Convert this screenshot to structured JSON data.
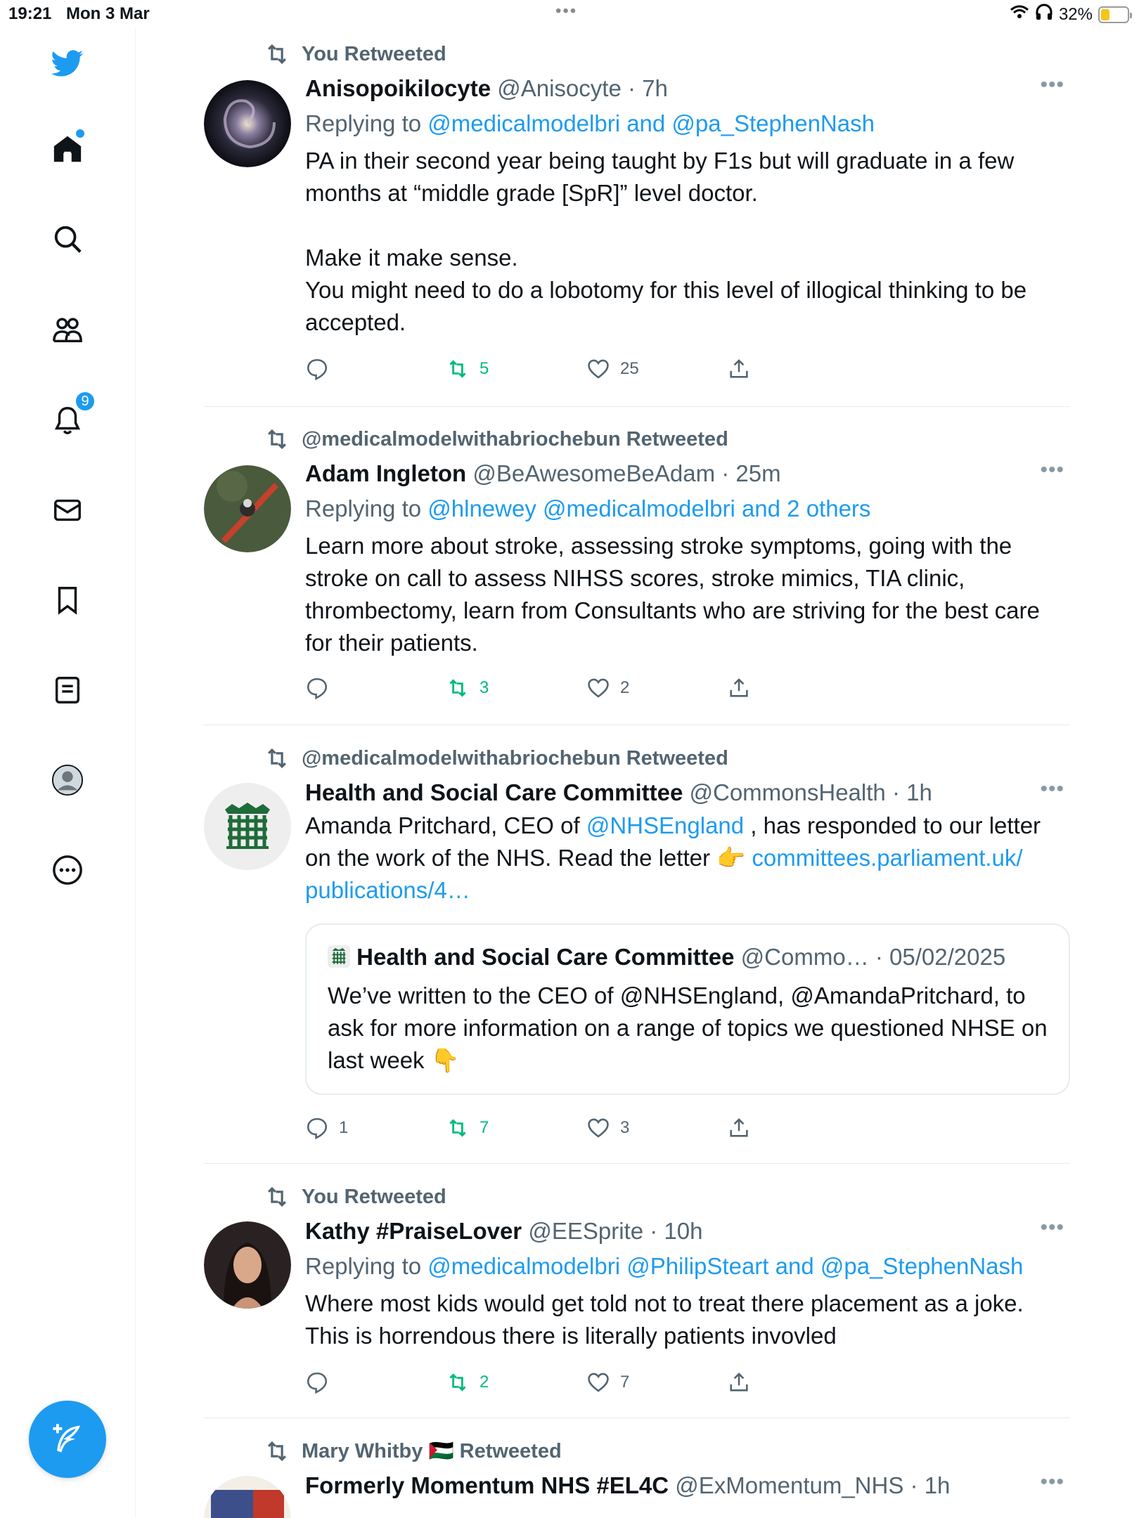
{
  "status_bar": {
    "time": "19:21",
    "date": "Mon 3 Mar",
    "dots": "•••",
    "battery": "32%",
    "battery_level": 0.32
  },
  "sidebar": {
    "notification_count": "9",
    "items": [
      "home-icon",
      "search-icon",
      "communities-icon",
      "notifications-icon",
      "messages-icon",
      "bookmarks-icon",
      "lists-icon",
      "profile-icon",
      "more-icon"
    ]
  },
  "tweets": [
    {
      "retweeted_by": "You Retweeted",
      "name": "Anisopoikilocyte",
      "handle": "@Anisocyte",
      "time": "· 7h",
      "replying_prefix": "Replying to ",
      "replying_to": "@medicalmodelbri and @pa_StephenNash",
      "body_1": "PA in their second year being taught by F1s but will graduate in a few months at “middle grade [SpR]” level doctor.",
      "body_2": "Make it make sense.",
      "body_3": "You might need to do a lobotomy for this level of illogical thinking to be accepted.",
      "replies": "",
      "retweets": "5",
      "likes": "25"
    },
    {
      "retweeted_by": "@medicalmodelwithabriochebun Retweeted",
      "name": "Adam Ingleton",
      "handle": "@BeAwesomeBeAdam",
      "time": "· 25m",
      "replying_prefix": "Replying to ",
      "replying_to": "@hlnewey @medicalmodelbri and 2 others",
      "body_1": "Learn more about stroke, assessing stroke symptoms, going with the stroke on call to assess NIHSS scores, stroke mimics, TIA clinic, thrombectomy, learn from Consultants who are striving for the best care for their patients.",
      "replies": "",
      "retweets": "3",
      "likes": "2"
    },
    {
      "retweeted_by": "@medicalmodelwithabriochebun Retweeted",
      "name": "Health and Social Care Committee",
      "handle": "@CommonsHealth",
      "time": "· 1h",
      "body_pre": "Amanda Pritchard, CEO of ",
      "body_mention": "@NHSEngland",
      "body_mid": " , has responded to our letter on the work of the NHS. Read the letter 👉 ",
      "body_link": "committees.parliament.uk/ publications/4…",
      "quote": {
        "name": "Health and Social Care Committee",
        "handle": "@Commo…",
        "date": "· 05/02/2025",
        "body": "We’ve written to the CEO of @NHSEngland, @AmandaPritchard, to ask for more information on a range of topics we questioned NHSE on last week 👇"
      },
      "replies": "1",
      "retweets": "7",
      "likes": "3"
    },
    {
      "retweeted_by": "You Retweeted",
      "name": "Kathy #PraiseLover",
      "handle": "@EESprite",
      "time": "· 10h",
      "replying_prefix": "Replying to ",
      "replying_to": "@medicalmodelbri @PhilipSteart and @pa_StephenNash",
      "body_1": "Where most kids would get told not to treat there placement as a joke. This is horrendous there is literally patients invovled",
      "replies": "",
      "retweets": "2",
      "likes": "7"
    },
    {
      "retweeted_by": "Mary Whitby 🇵🇸 Retweeted",
      "name": "Formerly Momentum NHS #EL4C",
      "handle": "@ExMomentum_NHS",
      "time": "· 1h"
    }
  ],
  "colors": {
    "accent": "#1d9bf0",
    "retweet": "#00ba7c",
    "muted": "#536471"
  }
}
